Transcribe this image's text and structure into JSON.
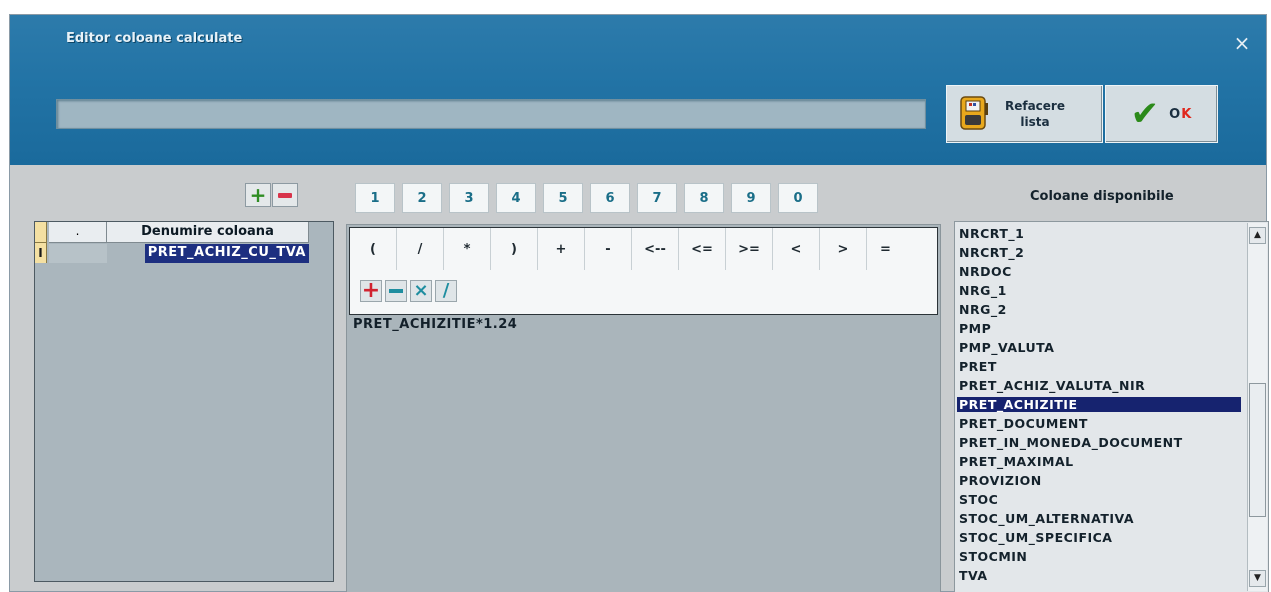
{
  "window": {
    "title": "Editor coloane calculate",
    "close_glyph": "×"
  },
  "toolbar": {
    "expression_value": "",
    "refacere_line1": "Refacere",
    "refacere_line2": "lista",
    "refacere_icon": "calculator-icon",
    "ok_label_main": "O",
    "ok_label_hot": "K",
    "ok_icon": "checkmark-icon",
    "ok_accent": "#e0261c"
  },
  "left_pane": {
    "add_glyph": "+",
    "headers": {
      "marker": "",
      "dot": ".",
      "name": "Denumire coloana"
    },
    "rows": [
      {
        "marker": "I",
        "dot": "",
        "name": "PRET_ACHIZ_CU_TVA"
      }
    ]
  },
  "digits": [
    "1",
    "2",
    "3",
    "4",
    "5",
    "6",
    "7",
    "8",
    "9",
    "0"
  ],
  "operators": [
    "(",
    "/",
    "*",
    ")",
    "+",
    "-",
    "<--",
    "<=",
    ">=",
    "<",
    ">",
    "="
  ],
  "editor": {
    "expression": "PRET_ACHIZITIE*1.24",
    "icon_buttons": [
      "plus-icon",
      "minus-icon",
      "times-icon",
      "slash-icon"
    ]
  },
  "available_columns": {
    "title": "Coloane disponibile",
    "items": [
      "NRCRT_1",
      "NRCRT_2",
      "NRDOC",
      "NRG_1",
      "NRG_2",
      "PMP",
      "PMP_VALUTA",
      "PRET",
      "PRET_ACHIZ_VALUTA_NIR",
      "PRET_ACHIZITIE",
      "PRET_DOCUMENT",
      "PRET_IN_MONEDA_DOCUMENT",
      "PRET_MAXIMAL",
      "PROVIZION",
      "STOC",
      "STOC_UM_ALTERNATIVA",
      "STOC_UM_SPECIFICA",
      "STOCMIN",
      "TVA"
    ],
    "selected": "PRET_ACHIZITIE",
    "selection_color": "#16236f"
  },
  "colors": {
    "titlebar": "#2374a6",
    "body": "#c9ccce",
    "accent_green": "#2f8d24",
    "accent_red": "#d8344b"
  }
}
